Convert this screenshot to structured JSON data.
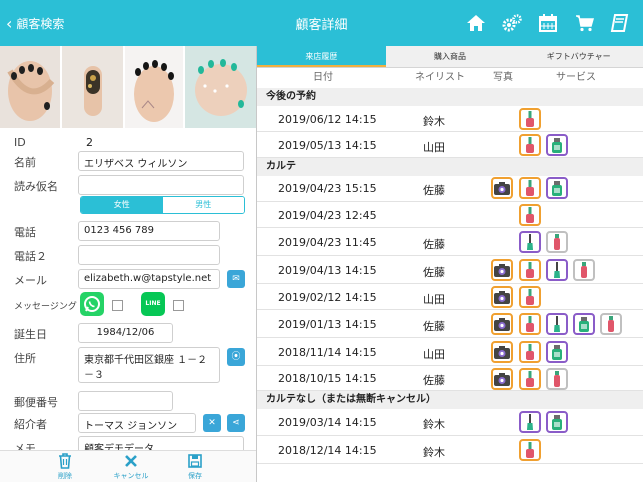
{
  "header": {
    "back_label": "顧客検索",
    "title": "顧客詳細",
    "icons": [
      "home-icon",
      "gears-icon",
      "calendar-icon",
      "cart-icon",
      "book-icon"
    ]
  },
  "form": {
    "id_label": "ID",
    "id_value": "2",
    "name_label": "名前",
    "name_value": "エリザベス ウィルソン",
    "kana_label": "読み仮名",
    "kana_value": "",
    "gender_female": "女性",
    "gender_male": "男性",
    "gender_selected": "女性",
    "phone_label": "電話",
    "phone_value": "0123 456 789",
    "phone2_label": "電話２",
    "phone2_value": "",
    "mail_label": "メール",
    "mail_value": "elizabeth.w@tapstyle.net",
    "messaging_label": "メッセージング",
    "line_label": "LINE",
    "birthday_label": "誕生日",
    "birthday_value": "1984/12/06",
    "address_label": "住所",
    "address_value": "東京都千代田区銀座 １－２－３",
    "postal_label": "郵便番号",
    "postal_value": "",
    "referrer_label": "紹介者",
    "referrer_value": "トーマス ジョンソン",
    "memo_label": "メモ",
    "memo_value": "顧客デモデータ"
  },
  "bottom": {
    "delete": "削除",
    "cancel": "キャンセル",
    "save": "保存"
  },
  "tabs": {
    "visits": "来店履歴",
    "products": "購入商品",
    "gift": "ギフトバウチャー",
    "active": "来店履歴"
  },
  "columns": {
    "date": "日付",
    "nailist": "ネイリスト",
    "photo": "写真",
    "service": "サービス"
  },
  "sections": {
    "upcoming": "今後の予約",
    "karte": "カルテ",
    "no_karte": "カルテなし（または無断キャンセル）"
  },
  "visits": [
    {
      "date": "2019/06/12 14:15",
      "nailist": "鈴木",
      "photo": false,
      "services": [
        "polish-red"
      ]
    },
    {
      "date": "2019/05/13 14:15",
      "nailist": "山田",
      "photo": false,
      "services": [
        "polish-red",
        "gel-purple"
      ]
    },
    {
      "date": "2019/04/23 15:15",
      "nailist": "佐藤",
      "photo": true,
      "services": [
        "polish-red",
        "gel-purple"
      ]
    },
    {
      "date": "2019/04/23 12:45",
      "nailist": "",
      "photo": false,
      "services": [
        "polish-red"
      ]
    },
    {
      "date": "2019/04/23 11:45",
      "nailist": "佐藤",
      "photo": false,
      "services": [
        "brush-purple",
        "tube-beige"
      ]
    },
    {
      "date": "2019/04/13 14:15",
      "nailist": "佐藤",
      "photo": true,
      "services": [
        "polish-red",
        "brush-purple",
        "tube-beige"
      ]
    },
    {
      "date": "2019/02/12 14:15",
      "nailist": "山田",
      "photo": true,
      "services": [
        "polish-red"
      ]
    },
    {
      "date": "2019/01/13 14:15",
      "nailist": "佐藤",
      "photo": true,
      "services": [
        "polish-red",
        "brush-purple",
        "gel-purple",
        "tube-beige"
      ]
    },
    {
      "date": "2018/11/14 14:15",
      "nailist": "山田",
      "photo": true,
      "services": [
        "polish-red",
        "gel-purple"
      ]
    },
    {
      "date": "2018/10/15 14:15",
      "nailist": "佐藤",
      "photo": true,
      "services": [
        "polish-red",
        "tube-beige"
      ]
    },
    {
      "date": "2019/03/14 14:15",
      "nailist": "鈴木",
      "photo": false,
      "services": [
        "brush-purple",
        "gel-purple"
      ]
    },
    {
      "date": "2018/12/14 14:15",
      "nailist": "鈴木",
      "photo": false,
      "services": [
        "polish-red"
      ]
    }
  ],
  "colors": {
    "accent": "#2bbfd6",
    "section_bg": "#efefef",
    "icon_border_orange": "#f0a030",
    "icon_border_purple": "#8a5cc8",
    "icon_border_gray": "#c0c0c0",
    "whatsapp": "#25d366",
    "line": "#06c755"
  }
}
